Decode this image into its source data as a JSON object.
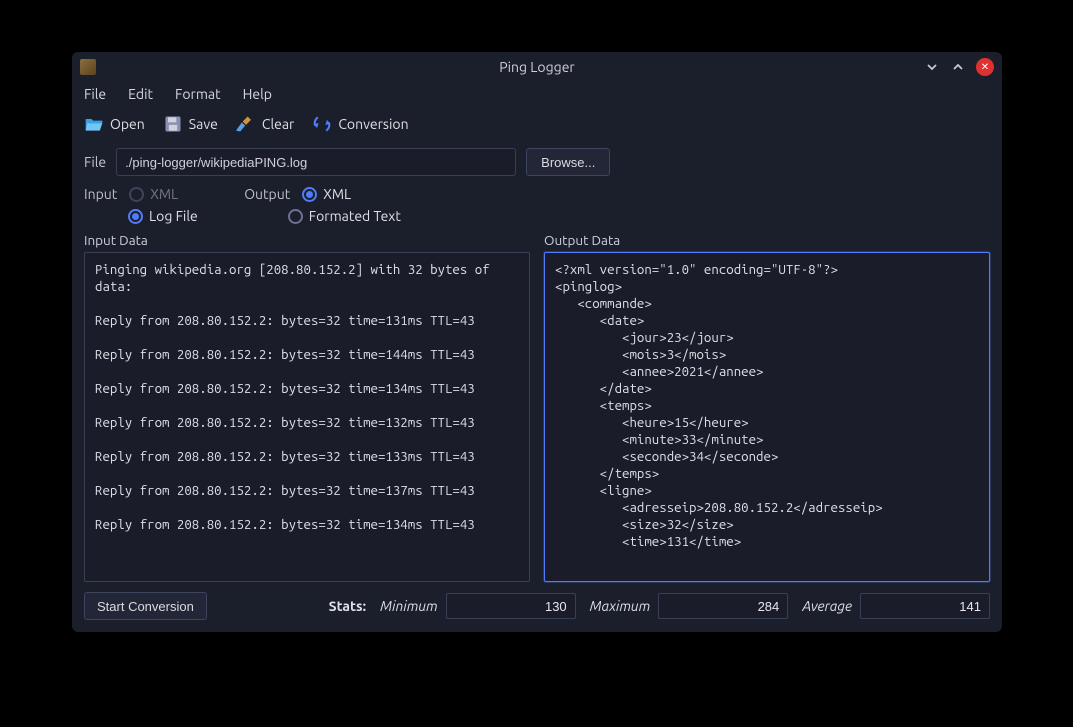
{
  "titlebar": {
    "title": "Ping Logger"
  },
  "menu": {
    "file": "File",
    "edit": "Edit",
    "format": "Format",
    "help": "Help"
  },
  "toolbar": {
    "open": "Open",
    "save": "Save",
    "clear": "Clear",
    "conversion": "Conversion"
  },
  "file": {
    "label": "File",
    "path": "./ping-logger/wikipediaPING.log",
    "browse": "Browse..."
  },
  "format": {
    "input_label": "Input",
    "output_label": "Output",
    "xml": "XML",
    "log_file": "Log File",
    "formated_text": "Formated Text"
  },
  "panels": {
    "input": "Input Data",
    "output": "Output Data"
  },
  "input_data": "Pinging wikipedia.org [208.80.152.2] with 32 bytes of data:\n\nReply from 208.80.152.2: bytes=32 time=131ms TTL=43\n\nReply from 208.80.152.2: bytes=32 time=144ms TTL=43\n\nReply from 208.80.152.2: bytes=32 time=134ms TTL=43\n\nReply from 208.80.152.2: bytes=32 time=132ms TTL=43\n\nReply from 208.80.152.2: bytes=32 time=133ms TTL=43\n\nReply from 208.80.152.2: bytes=32 time=137ms TTL=43\n\nReply from 208.80.152.2: bytes=32 time=134ms TTL=43\n",
  "output_data": "<?xml version=\"1.0\" encoding=\"UTF-8\"?>\n<pinglog>\n   <commande>\n      <date>\n         <jour>23</jour>\n         <mois>3</mois>\n         <annee>2021</annee>\n      </date>\n      <temps>\n         <heure>15</heure>\n         <minute>33</minute>\n         <seconde>34</seconde>\n      </temps>\n      <ligne>\n         <adresseip>208.80.152.2</adresseip>\n         <size>32</size>\n         <time>131</time>\n",
  "bottom": {
    "start": "Start Conversion",
    "stats_label": "Stats:",
    "minimum_label": "Minimum",
    "minimum_value": "130",
    "maximum_label": "Maximum",
    "maximum_value": "284",
    "average_label": "Average",
    "average_value": "141"
  }
}
